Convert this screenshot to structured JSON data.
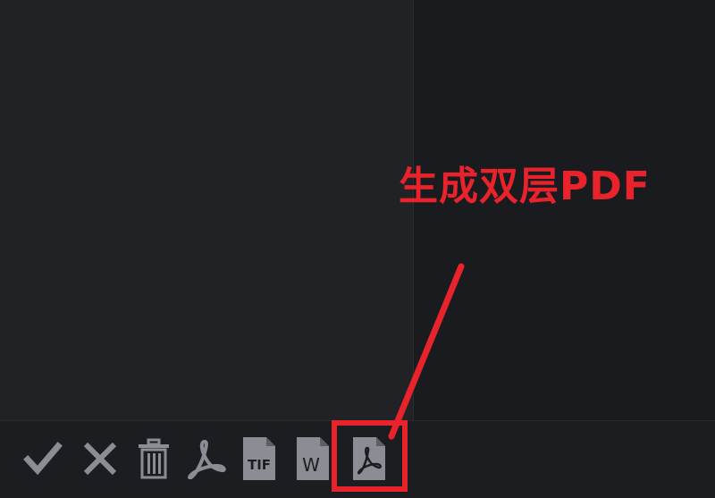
{
  "annotation": {
    "text": "生成双层PDF",
    "color": "#e8232c"
  },
  "toolbar": {
    "tools": [
      {
        "name": "confirm",
        "icon": "checkmark-icon"
      },
      {
        "name": "cancel",
        "icon": "close-x-icon"
      },
      {
        "name": "delete",
        "icon": "trash-icon"
      },
      {
        "name": "export-pdf",
        "icon": "acrobat-icon"
      },
      {
        "name": "export-tif",
        "icon": "tif-file-icon",
        "label": "TIF"
      },
      {
        "name": "export-word",
        "icon": "word-file-icon",
        "label": "W"
      },
      {
        "name": "generate-dual-layer-pdf",
        "icon": "pdf-file-icon",
        "highlighted": true
      }
    ]
  },
  "colors": {
    "icon": "#8a8e94",
    "background": "#1b1c1f",
    "highlight": "#e8232c"
  }
}
